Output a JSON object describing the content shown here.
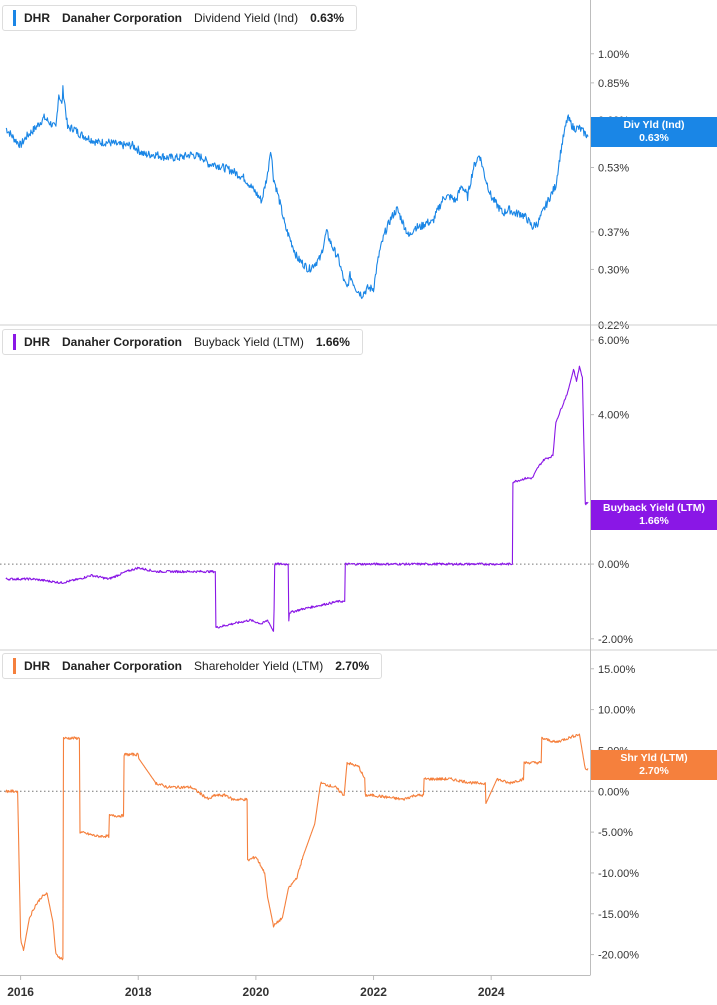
{
  "panels": [
    {
      "ticker": "DHR",
      "company": "Danaher Corporation",
      "metric": "Dividend Yield (Ind)",
      "value": "0.63%",
      "badge_line1": "Div Yld (Ind)",
      "badge_line2": "0.63%",
      "color": "#1a86e6"
    },
    {
      "ticker": "DHR",
      "company": "Danaher Corporation",
      "metric": "Buyback Yield (LTM)",
      "value": "1.66%",
      "badge_line1": "Buyback Yield (LTM)",
      "badge_line2": "1.66%",
      "color": "#8a17e6"
    },
    {
      "ticker": "DHR",
      "company": "Danaher Corporation",
      "metric": "Shareholder Yield (LTM)",
      "value": "2.70%",
      "badge_line1": "Shr Yld (LTM)",
      "badge_line2": "2.70%",
      "color": "#f5803d"
    }
  ],
  "chart_data": [
    {
      "type": "line",
      "series": [
        {
          "name": "Div Yld (Ind)",
          "color": "#1a86e6",
          "x": [
            2015.75,
            2015.9,
            2016.0,
            2016.1,
            2016.25,
            2016.4,
            2016.5,
            2016.6,
            2016.65,
            2016.7,
            2016.72,
            2016.8,
            2016.9,
            2017.0,
            2017.1,
            2017.3,
            2017.5,
            2017.7,
            2017.9,
            2018.1,
            2018.3,
            2018.5,
            2018.7,
            2018.9,
            2019.1,
            2019.2,
            2019.3,
            2019.45,
            2019.6,
            2019.8,
            2019.95,
            2020.1,
            2020.2,
            2020.25,
            2020.3,
            2020.4,
            2020.5,
            2020.6,
            2020.7,
            2020.8,
            2020.9,
            2021.0,
            2021.1,
            2021.2,
            2021.3,
            2021.4,
            2021.5,
            2021.55,
            2021.6,
            2021.7,
            2021.8,
            2021.9,
            2022.0,
            2022.1,
            2022.2,
            2022.3,
            2022.4,
            2022.5,
            2022.6,
            2022.7,
            2022.8,
            2022.9,
            2023.0,
            2023.1,
            2023.2,
            2023.3,
            2023.4,
            2023.5,
            2023.6,
            2023.7,
            2023.8,
            2023.9,
            2024.0,
            2024.1,
            2024.2,
            2024.3,
            2024.4,
            2024.5,
            2024.6,
            2024.7,
            2024.8,
            2024.9,
            2025.0,
            2025.1,
            2025.2,
            2025.3,
            2025.4,
            2025.5,
            2025.6,
            2025.65
          ],
          "values": [
            0.66,
            0.62,
            0.6,
            0.63,
            0.66,
            0.7,
            0.68,
            0.66,
            0.8,
            0.75,
            0.82,
            0.66,
            0.66,
            0.64,
            0.63,
            0.61,
            0.61,
            0.6,
            0.6,
            0.57,
            0.57,
            0.56,
            0.56,
            0.57,
            0.56,
            0.54,
            0.54,
            0.53,
            0.52,
            0.5,
            0.47,
            0.44,
            0.51,
            0.59,
            0.5,
            0.44,
            0.38,
            0.35,
            0.32,
            0.31,
            0.3,
            0.31,
            0.32,
            0.37,
            0.34,
            0.32,
            0.28,
            0.27,
            0.29,
            0.27,
            0.26,
            0.27,
            0.27,
            0.33,
            0.37,
            0.4,
            0.42,
            0.39,
            0.36,
            0.38,
            0.38,
            0.39,
            0.39,
            0.42,
            0.45,
            0.45,
            0.44,
            0.48,
            0.45,
            0.53,
            0.57,
            0.5,
            0.45,
            0.43,
            0.41,
            0.42,
            0.41,
            0.41,
            0.4,
            0.38,
            0.39,
            0.42,
            0.45,
            0.48,
            0.6,
            0.7,
            0.66,
            0.66,
            0.64,
            0.63
          ]
        }
      ],
      "y_ticks": [
        "1.00%",
        "0.85%",
        "0.69%",
        "0.53%",
        "0.37%",
        "0.30%",
        "0.22%"
      ],
      "y_tick_values": [
        1.0,
        0.85,
        0.69,
        0.53,
        0.37,
        0.3,
        0.22
      ],
      "y_scale": "log",
      "ylim": [
        0.22,
        1.35
      ]
    },
    {
      "type": "line",
      "series": [
        {
          "name": "Buyback Yield (LTM)",
          "color": "#8a17e6",
          "x": [
            2015.75,
            2016.2,
            2016.7,
            2017.0,
            2017.2,
            2017.5,
            2017.8,
            2018.0,
            2018.3,
            2018.6,
            2018.9,
            2019.2,
            2019.31,
            2019.32,
            2019.6,
            2019.9,
            2020.1,
            2020.2,
            2020.3,
            2020.31,
            2020.32,
            2020.55,
            2020.56,
            2020.57,
            2020.8,
            2021.1,
            2021.4,
            2021.51,
            2021.52,
            2022.0,
            2022.5,
            2023.0,
            2023.5,
            2024.0,
            2024.36,
            2024.37,
            2024.6,
            2024.7,
            2024.8,
            2024.9,
            2025.05,
            2025.1,
            2025.2,
            2025.3,
            2025.4,
            2025.45,
            2025.5,
            2025.55,
            2025.6,
            2025.65
          ],
          "values": [
            -0.4,
            -0.4,
            -0.5,
            -0.4,
            -0.3,
            -0.4,
            -0.2,
            -0.1,
            -0.2,
            -0.2,
            -0.2,
            -0.2,
            -0.2,
            -1.7,
            -1.6,
            -1.5,
            -1.6,
            -1.5,
            -1.8,
            -1.2,
            0.0,
            0.0,
            -1.5,
            -1.3,
            -1.2,
            -1.1,
            -1.0,
            -1.0,
            0.0,
            0.0,
            0.0,
            0.0,
            0.0,
            0.0,
            0.0,
            2.2,
            2.3,
            2.3,
            2.6,
            2.8,
            2.9,
            3.8,
            4.2,
            4.6,
            5.2,
            4.9,
            5.3,
            5.0,
            1.6,
            1.66
          ]
        }
      ],
      "y_ticks": [
        "6.00%",
        "4.00%",
        "0.00%",
        "-2.00%"
      ],
      "y_tick_values": [
        6,
        4,
        0,
        -2
      ],
      "reference_line": 0,
      "ylim": [
        -2.3,
        6.4
      ]
    },
    {
      "type": "line",
      "series": [
        {
          "name": "Shr Yld (LTM)",
          "color": "#f5803d",
          "x": [
            2015.75,
            2015.95,
            2016.0,
            2016.05,
            2016.15,
            2016.25,
            2016.35,
            2016.45,
            2016.55,
            2016.6,
            2016.7,
            2016.72,
            2016.73,
            2017.0,
            2017.01,
            2017.3,
            2017.5,
            2017.51,
            2017.75,
            2017.76,
            2018.0,
            2018.01,
            2018.3,
            2018.5,
            2018.9,
            2019.2,
            2019.3,
            2019.5,
            2019.6,
            2019.85,
            2019.86,
            2020.0,
            2020.15,
            2020.2,
            2020.3,
            2020.45,
            2020.55,
            2020.7,
            2020.8,
            2021.0,
            2021.1,
            2021.35,
            2021.5,
            2021.55,
            2021.75,
            2021.85,
            2021.86,
            2022.0,
            2022.5,
            2022.7,
            2022.85,
            2022.86,
            2023.3,
            2023.7,
            2023.9,
            2023.91,
            2024.1,
            2024.3,
            2024.55,
            2024.56,
            2024.85,
            2024.86,
            2025.1,
            2025.3,
            2025.5,
            2025.6,
            2025.65
          ],
          "values": [
            0.0,
            0.0,
            -18.0,
            -19.5,
            -15.5,
            -14.0,
            -13.0,
            -12.5,
            -16.0,
            -20.0,
            -20.5,
            -20.5,
            6.5,
            6.5,
            -5.0,
            -5.5,
            -5.5,
            -3.0,
            -3.0,
            4.5,
            4.5,
            4.0,
            1.0,
            0.5,
            0.5,
            -1.0,
            -0.5,
            -0.5,
            -1.0,
            -1.0,
            -8.5,
            -8.0,
            -10.0,
            -13.0,
            -16.5,
            -15.5,
            -12.0,
            -10.5,
            -8.0,
            -4.0,
            1.0,
            0.5,
            -0.5,
            3.5,
            3.0,
            1.5,
            -0.5,
            -0.5,
            -1.0,
            -0.5,
            -0.5,
            1.5,
            1.5,
            1.0,
            1.0,
            -1.5,
            1.5,
            1.0,
            1.5,
            3.5,
            3.5,
            6.5,
            6.0,
            6.5,
            7.0,
            2.7,
            2.7
          ]
        }
      ],
      "y_ticks": [
        "15.00%",
        "10.00%",
        "5.00%",
        "0.00%",
        "-5.00%",
        "-10.00%",
        "-15.00%",
        "-20.00%"
      ],
      "y_tick_values": [
        15,
        10,
        5,
        0,
        -5,
        -10,
        -15,
        -20
      ],
      "reference_line": 0,
      "ylim": [
        -22.5,
        17.3
      ]
    }
  ],
  "x_axis": {
    "ticks": [
      "2016",
      "2018",
      "2020",
      "2022",
      "2024"
    ],
    "tick_values": [
      2016,
      2018,
      2020,
      2022,
      2024
    ],
    "xlim": [
      2015.65,
      2025.68
    ]
  }
}
